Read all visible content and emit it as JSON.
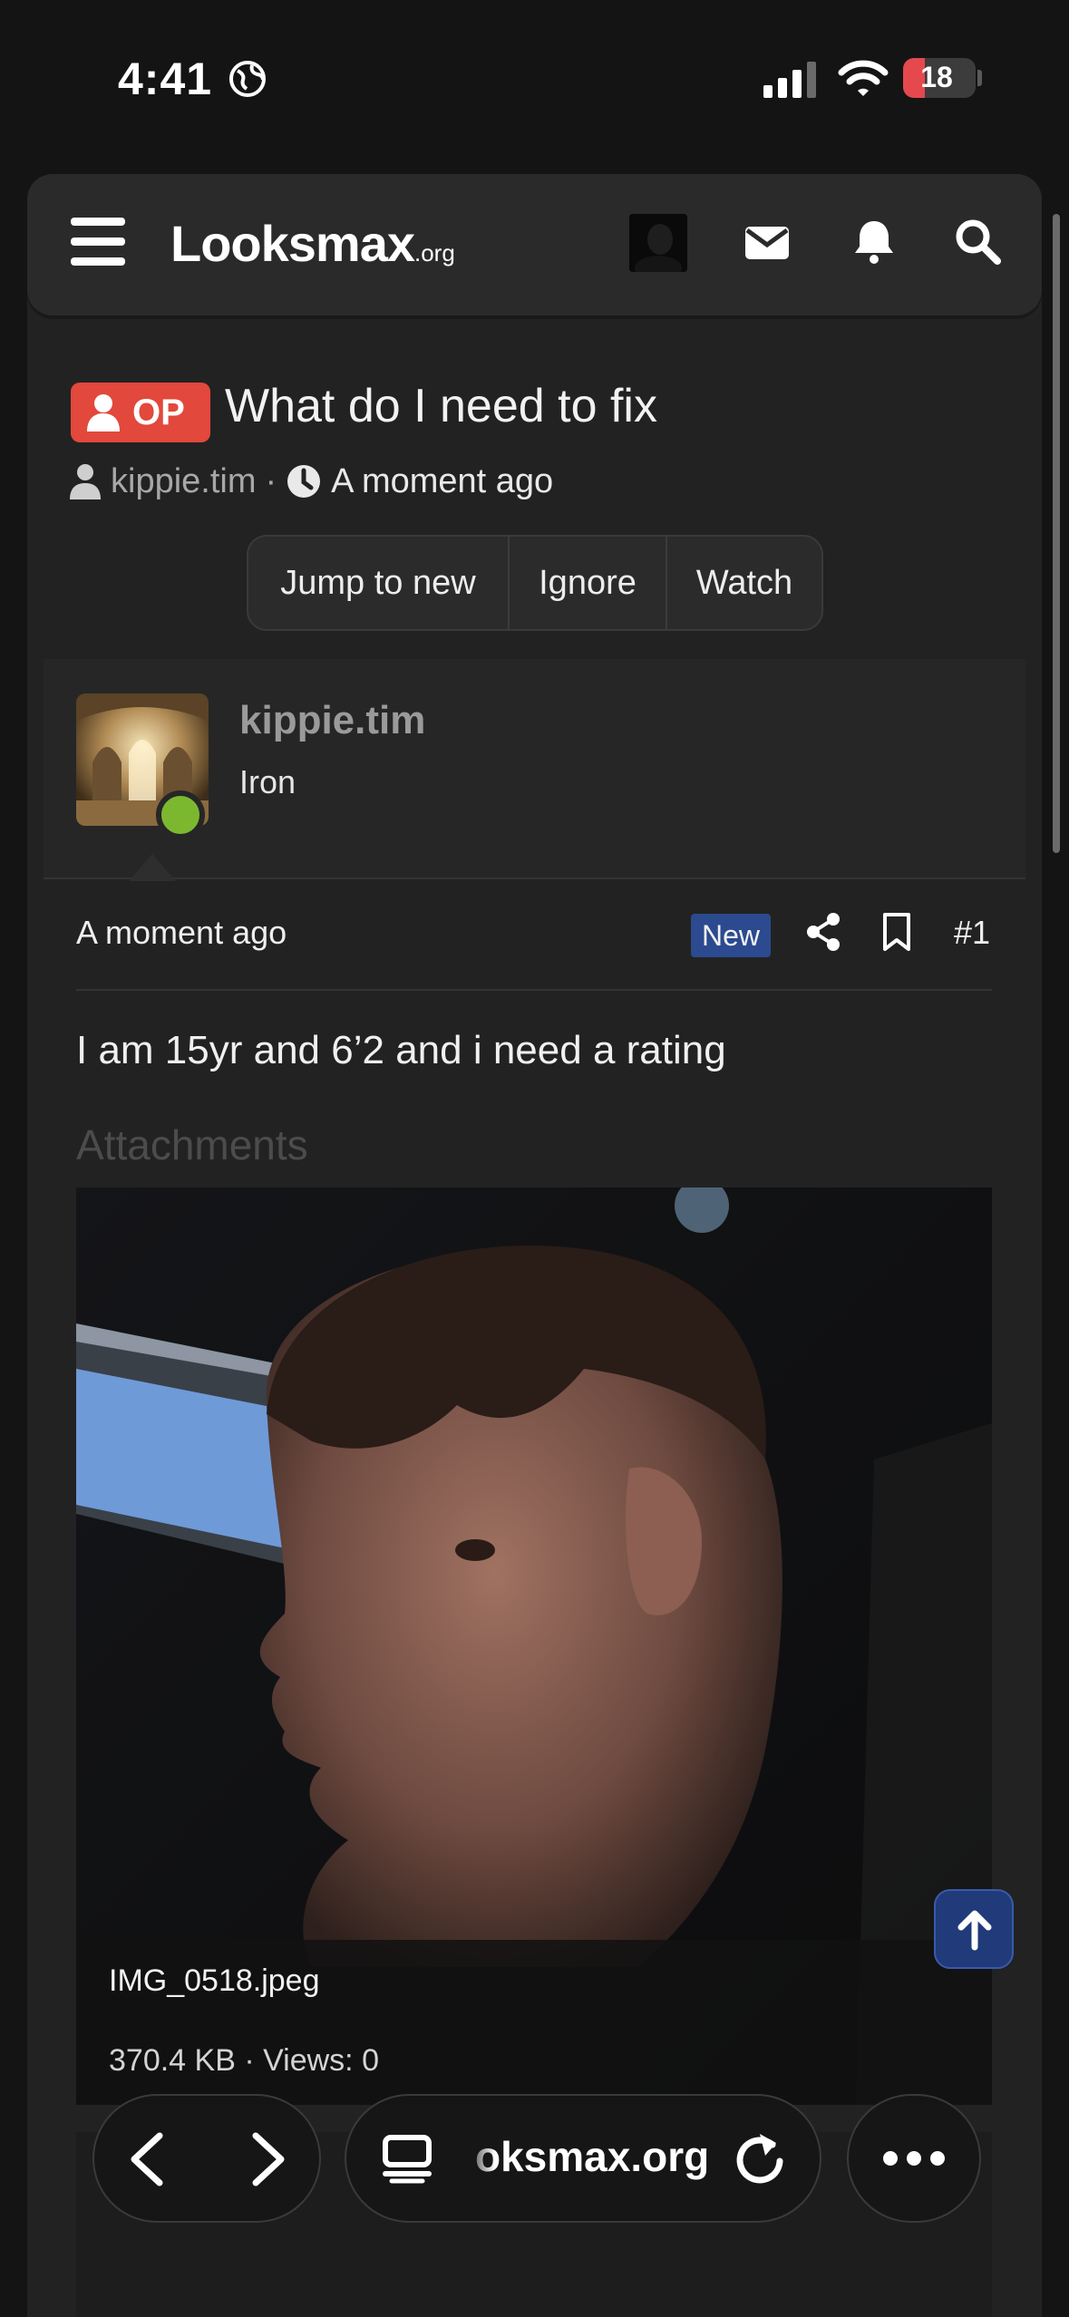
{
  "status_bar": {
    "time": "4:41",
    "battery": "18"
  },
  "header": {
    "logo_main": "Looksmax",
    "logo_tld": ".org"
  },
  "thread": {
    "op_badge": "OP",
    "title": "What do I need to fix",
    "author": "kippie.tim",
    "separator": "·",
    "time": "A moment ago",
    "buttons": [
      "Jump to new",
      "Ignore",
      "Watch"
    ]
  },
  "post": {
    "username": "kippie.tim",
    "user_title": "Iron",
    "date": "A moment ago",
    "new_badge": "New",
    "number": "#1",
    "body": "I am 15yr and 6’2 and i need a rating",
    "attachments_label": "Attachments",
    "attachment": {
      "filename": "IMG_0518.jpeg",
      "info": "370.4 KB · Views: 0"
    }
  },
  "browser": {
    "url": "oksmax.org"
  },
  "colors": {
    "accent_red": "#e2483c",
    "new_badge": "#2b4a8f",
    "online": "#7cb82f",
    "scroll_top": "#203a7a"
  }
}
